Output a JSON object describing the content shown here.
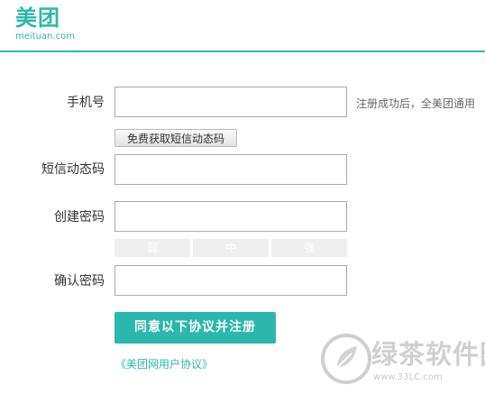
{
  "header": {
    "logo_cn": "美团",
    "logo_en": "meituan.com",
    "accent_color": "#2bb8aa"
  },
  "form": {
    "phone_label": "手机号",
    "phone_value": "",
    "phone_hint": "注册成功后，全美团通用",
    "sms_button_label": "免费获取短信动态码",
    "sms_code_label": "短信动态码",
    "sms_code_value": "",
    "password_label": "创建密码",
    "password_value": "",
    "strength_levels": [
      "弱",
      "中",
      "强"
    ],
    "confirm_label": "确认密码",
    "confirm_value": "",
    "submit_label": "同意以下协议并注册",
    "agreement_link": "《美团网用户协议》"
  },
  "watermark": {
    "text": "绿茶软件园",
    "url": "www.33LC.com"
  }
}
